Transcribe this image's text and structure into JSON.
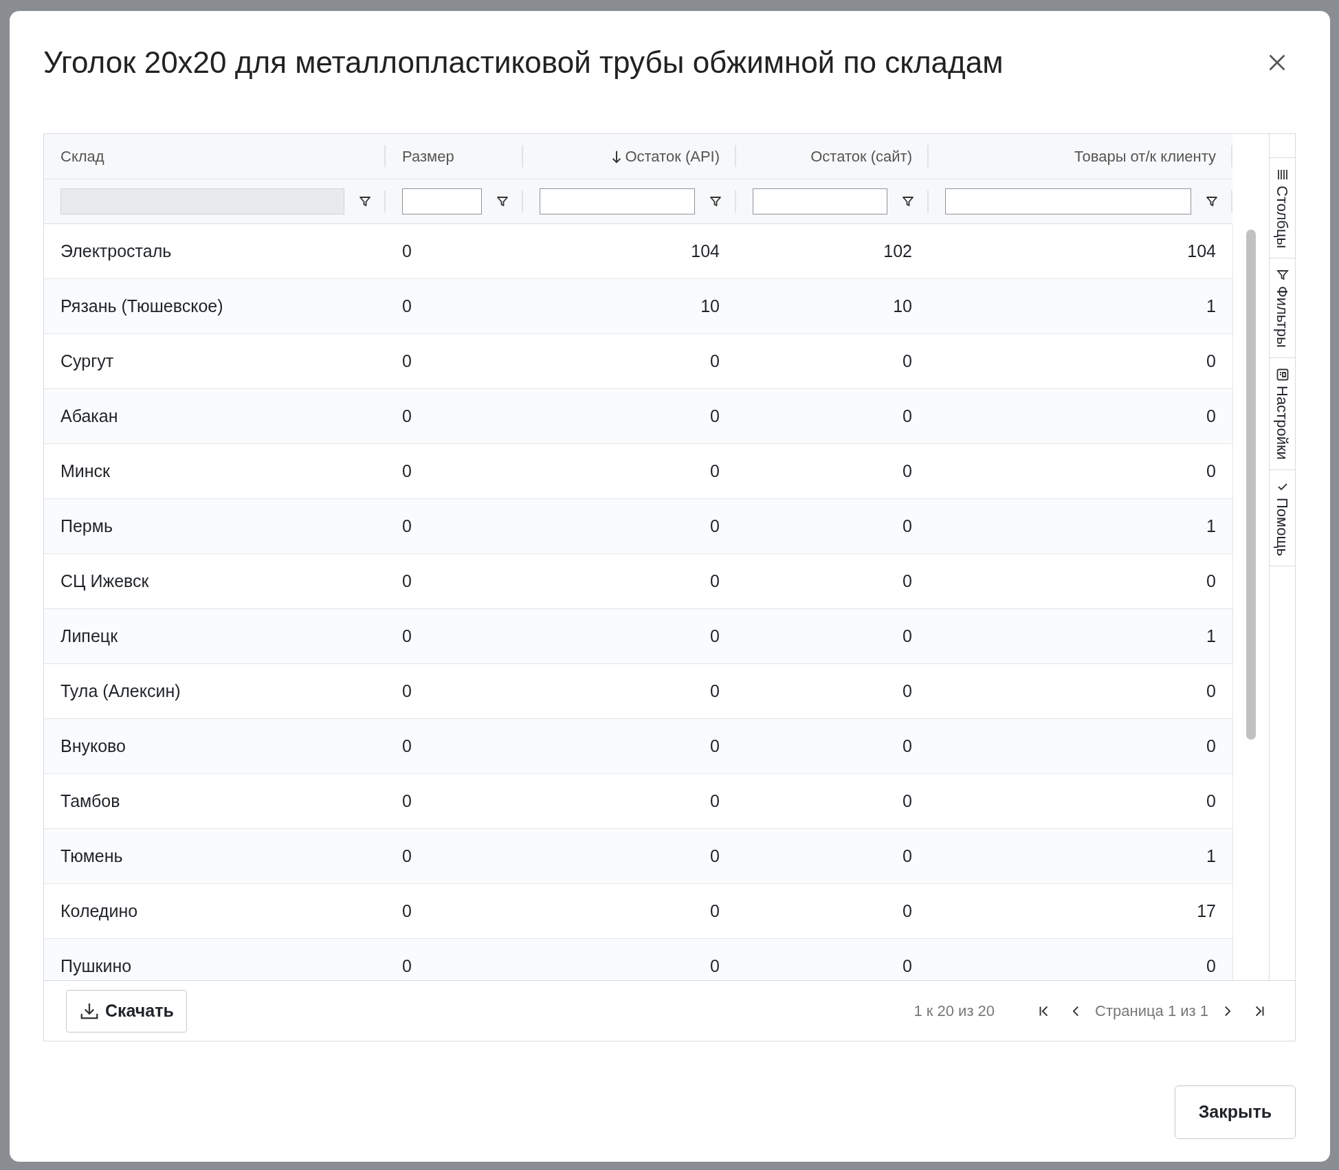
{
  "dialog": {
    "title": "Уголок 20x20 для металлопластиковой трубы обжимной по складам"
  },
  "table": {
    "columns": [
      {
        "label": "Склад",
        "sorted": false,
        "filter_disabled": true
      },
      {
        "label": "Размер",
        "sorted": false,
        "filter_disabled": false
      },
      {
        "label": "Остаток (API)",
        "sorted": true,
        "filter_disabled": false
      },
      {
        "label": "Остаток (сайт)",
        "sorted": false,
        "filter_disabled": false
      },
      {
        "label": "Товары от/к клиенту",
        "sorted": false,
        "filter_disabled": false
      }
    ],
    "rows": [
      [
        "Электросталь",
        "0",
        "104",
        "102",
        "104"
      ],
      [
        "Рязань (Тюшевское)",
        "0",
        "10",
        "10",
        "1"
      ],
      [
        "Сургут",
        "0",
        "0",
        "0",
        "0"
      ],
      [
        "Абакан",
        "0",
        "0",
        "0",
        "0"
      ],
      [
        "Минск",
        "0",
        "0",
        "0",
        "0"
      ],
      [
        "Пермь",
        "0",
        "0",
        "0",
        "1"
      ],
      [
        "СЦ Ижевск",
        "0",
        "0",
        "0",
        "0"
      ],
      [
        "Липецк",
        "0",
        "0",
        "0",
        "1"
      ],
      [
        "Тула (Алексин)",
        "0",
        "0",
        "0",
        "0"
      ],
      [
        "Внуково",
        "0",
        "0",
        "0",
        "0"
      ],
      [
        "Тамбов",
        "0",
        "0",
        "0",
        "0"
      ],
      [
        "Тюмень",
        "0",
        "0",
        "0",
        "1"
      ],
      [
        "Коледино",
        "0",
        "0",
        "0",
        "17"
      ],
      [
        "Пушкино",
        "0",
        "0",
        "0",
        "0"
      ]
    ]
  },
  "side_tabs": [
    {
      "label": "Столбцы",
      "kind": "columns"
    },
    {
      "label": "Фильтры",
      "kind": "filter"
    },
    {
      "label": "Настройки",
      "kind": "settings"
    },
    {
      "label": "Помощь",
      "kind": "check"
    }
  ],
  "footer": {
    "download": "Скачать",
    "range": "1 к 20 из 20",
    "page": "Страница 1 из 1"
  },
  "buttons": {
    "close": "Закрыть"
  }
}
